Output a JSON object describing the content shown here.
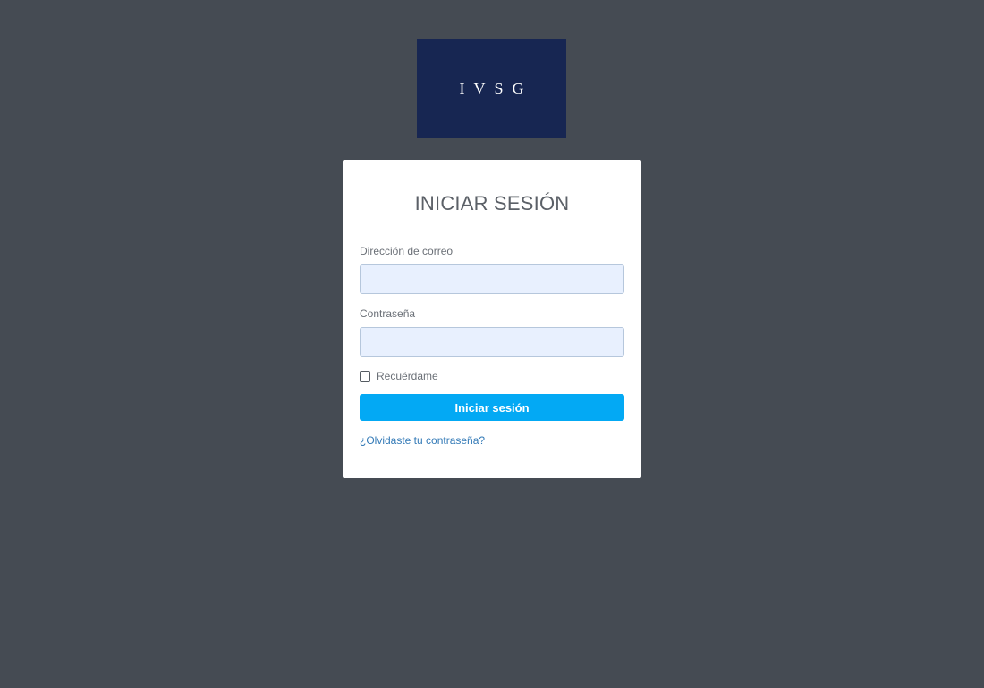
{
  "logo": {
    "text": "IVSG",
    "background": "#172652"
  },
  "login": {
    "title": "INICIAR SESIÓN",
    "email_label": "Dirección de correo",
    "email_value": "",
    "password_label": "Contraseña",
    "password_value": "",
    "remember_label": "Recuérdame",
    "remember_checked": false,
    "submit_label": "Iniciar sesión",
    "forgot_link": "¿Olvidaste tu contraseña?"
  },
  "colors": {
    "page_background": "#454b53",
    "button": "#03a9f4",
    "link": "#337ab7",
    "input_background": "#e8f0fe"
  }
}
